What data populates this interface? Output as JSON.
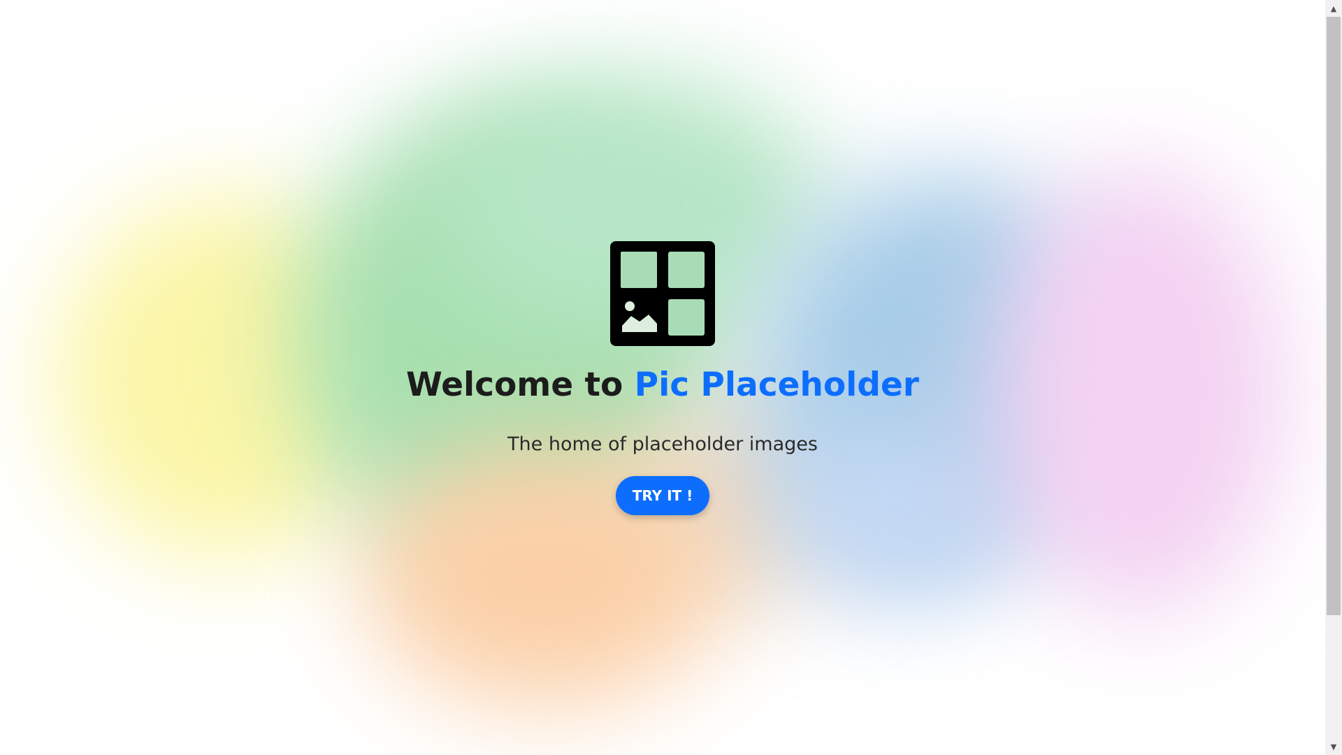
{
  "hero": {
    "logo_icon": "image-grid-icon",
    "headline_prefix": "Welcome to ",
    "headline_brand": "Pic Placeholder",
    "subtitle": "The home of placeholder images",
    "cta_label": "TRY IT !"
  },
  "scrollbar": {
    "up_arrow": "▲",
    "down_arrow": "▼"
  },
  "colors": {
    "brand": "#0d6efd",
    "text": "#1c1c1c"
  }
}
